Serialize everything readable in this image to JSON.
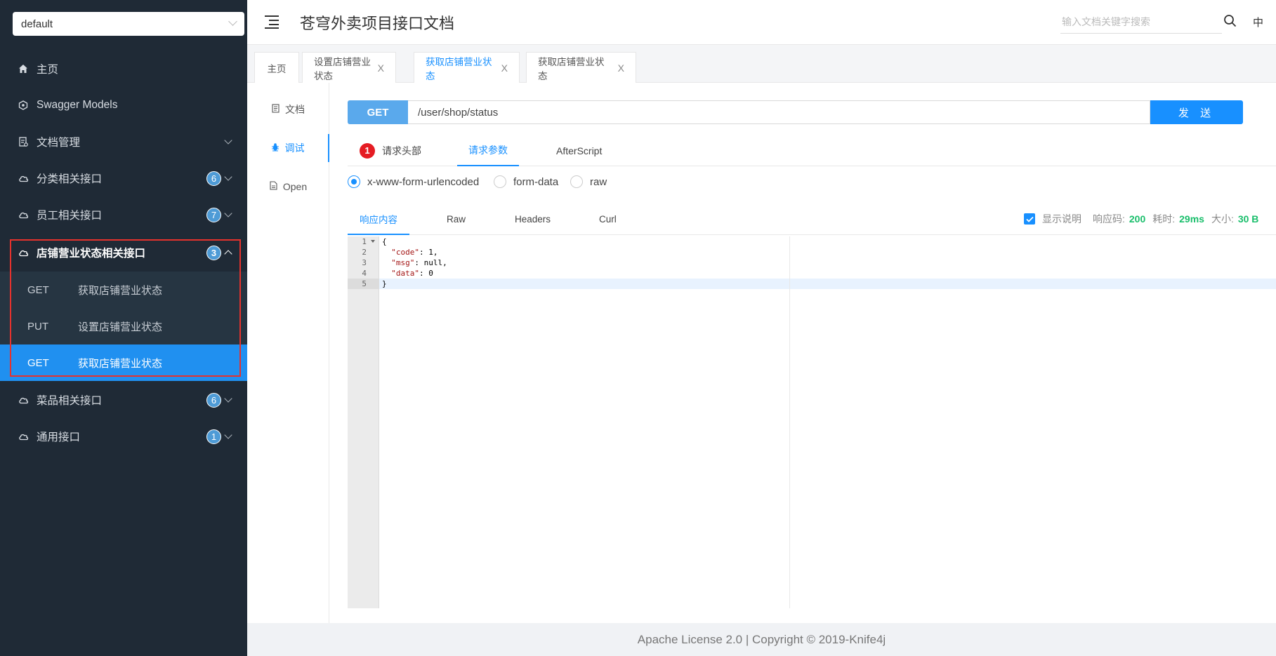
{
  "sidebar": {
    "group_select": "default",
    "menu": [
      {
        "label": "主页",
        "icon": "home-icon"
      },
      {
        "label": "Swagger Models",
        "icon": "models-icon"
      },
      {
        "label": "文档管理",
        "icon": "doc-manage-icon"
      },
      {
        "label": "分类相关接口",
        "icon": "cloud-icon",
        "badge": "6"
      },
      {
        "label": "员工相关接口",
        "icon": "cloud-icon",
        "badge": "7"
      },
      {
        "label": "店铺营业状态相关接口",
        "icon": "cloud-icon",
        "badge": "3"
      },
      {
        "label": "菜品相关接口",
        "icon": "cloud-icon",
        "badge": "6"
      },
      {
        "label": "通用接口",
        "icon": "cloud-icon",
        "badge": "1"
      }
    ],
    "sub_items": [
      {
        "method": "GET",
        "label": "获取店铺营业状态"
      },
      {
        "method": "PUT",
        "label": "设置店铺营业状态"
      },
      {
        "method": "GET",
        "label": "获取店铺营业状态"
      }
    ]
  },
  "header": {
    "title": "苍穹外卖项目接口文档",
    "search_placeholder": "输入文档关键字搜索",
    "lang": "中"
  },
  "tabs": [
    {
      "label": "主页"
    },
    {
      "label": "设置店铺营业状态"
    },
    {
      "label": "获取店铺营业状态"
    },
    {
      "label": "获取店铺营业状态"
    }
  ],
  "tab_close": "X",
  "subnav": [
    {
      "label": "文档",
      "icon": "document-icon"
    },
    {
      "label": "调试",
      "icon": "bug-icon"
    },
    {
      "label": "Open",
      "icon": "file-icon"
    }
  ],
  "request": {
    "method": "GET",
    "url": "/user/shop/status",
    "send_label": "发 送"
  },
  "req_tabs": {
    "headers_badge": "1",
    "headers": "请求头部",
    "params": "请求参数",
    "after_script": "AfterScript"
  },
  "content_types": [
    "x-www-form-urlencoded",
    "form-data",
    "raw"
  ],
  "resp_tabs": [
    "响应内容",
    "Raw",
    "Headers",
    "Curl"
  ],
  "resp_info": {
    "show_desc": "显示说明",
    "code_label": "响应码:",
    "code": "200",
    "time_label": "耗时:",
    "time": "29ms",
    "size_label": "大小:",
    "size": "30 B"
  },
  "code_lines": [
    "{",
    "  \"code\": 1,",
    "  \"msg\": null,",
    "  \"data\": 0",
    "}"
  ],
  "line_numbers": [
    "1",
    "2",
    "3",
    "4",
    "5"
  ],
  "footer": "Apache License 2.0 | Copyright © 2019-Knife4j",
  "colors": {
    "sidebar_bg": "#1f2a36",
    "active_blue": "#1890ff",
    "method_get": "#5aa9ec",
    "highlight_red": "#e5322d",
    "success_green": "#19be6b"
  }
}
